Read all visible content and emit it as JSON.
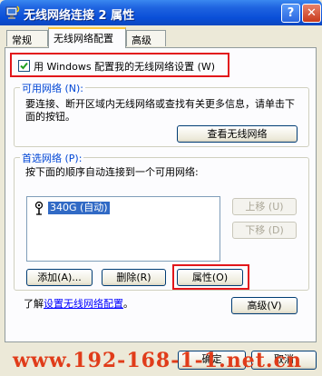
{
  "window": {
    "title": "无线网络连接 2 属性",
    "help_label": "?",
    "close_label": "✕"
  },
  "tabs": [
    {
      "label": "常规",
      "active": false
    },
    {
      "label": "无线网络配置",
      "active": true
    },
    {
      "label": "高级",
      "active": false
    }
  ],
  "use_windows": {
    "label": "用 Windows 配置我的无线网络设置 (W)",
    "checked": true
  },
  "available": {
    "legend": "可用网络 (N):",
    "description": "要连接、断开区域内无线网络或查找有关更多信息，请单击下面的按钮。",
    "view_button": "查看无线网络"
  },
  "preferred": {
    "legend": "首选网络 (P):",
    "description": "按下面的顺序自动连接到一个可用网络:",
    "networks": [
      {
        "label": "340G (自动)",
        "icon": "wireless-antenna-icon",
        "selected": true
      }
    ],
    "move_up": "上移 (U)",
    "move_down": "下移 (D)",
    "add": "添加(A)...",
    "remove": "删除(R)",
    "properties": "属性(O)"
  },
  "learn": {
    "prefix": "了解",
    "link": "设置无线网络配置",
    "suffix": "。"
  },
  "advanced_button": "高级(V)",
  "ok_button": "确定",
  "cancel_button": "取消",
  "watermark": "www.192-168-1-1.net.cn",
  "colors": {
    "title_bar": "#0a4fd8",
    "dialog_bg": "#ece9d8",
    "highlight": "#e2161a",
    "selection": "#316ac5",
    "legend_text": "#0046d5",
    "watermark": "#e03c1a"
  }
}
